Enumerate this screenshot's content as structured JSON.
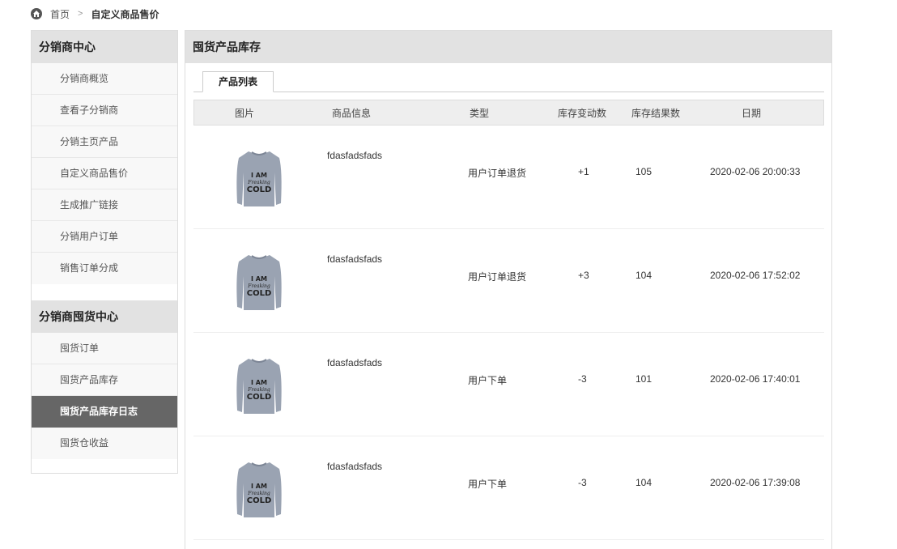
{
  "breadcrumb": {
    "home": "首页",
    "separator": ">",
    "current": "自定义商品售价"
  },
  "sidebar": {
    "sections": [
      {
        "title": "分销商中心",
        "items": [
          {
            "label": "分销商概览",
            "active": false
          },
          {
            "label": "查看子分销商",
            "active": false
          },
          {
            "label": "分销主页产品",
            "active": false
          },
          {
            "label": "自定义商品售价",
            "active": false
          },
          {
            "label": "生成推广链接",
            "active": false
          },
          {
            "label": "分销用户订单",
            "active": false
          },
          {
            "label": "销售订单分成",
            "active": false
          }
        ]
      },
      {
        "title": "分销商囤货中心",
        "items": [
          {
            "label": "囤货订单",
            "active": false
          },
          {
            "label": "囤货产品库存",
            "active": false
          },
          {
            "label": "囤货产品库存日志",
            "active": true
          },
          {
            "label": "囤货仓收益",
            "active": false
          }
        ]
      }
    ]
  },
  "main": {
    "title": "囤货产品库存",
    "tab": "产品列表",
    "columns": [
      "图片",
      "商品信息",
      "类型",
      "库存变动数",
      "库存结果数",
      "日期"
    ],
    "rows": [
      {
        "info": "fdasfadsfads",
        "type": "用户订单退货",
        "change": "+1",
        "result": "105",
        "date": "2020-02-06 20:00:33"
      },
      {
        "info": "fdasfadsfads",
        "type": "用户订单退货",
        "change": "+3",
        "result": "104",
        "date": "2020-02-06 17:52:02"
      },
      {
        "info": "fdasfadsfads",
        "type": "用户下单",
        "change": "-3",
        "result": "101",
        "date": "2020-02-06 17:40:01"
      },
      {
        "info": "fdasfadsfads",
        "type": "用户下单",
        "change": "-3",
        "result": "104",
        "date": "2020-02-06 17:39:08"
      }
    ],
    "product_image_text": [
      "I AM",
      "Freaking",
      "COLD"
    ]
  }
}
